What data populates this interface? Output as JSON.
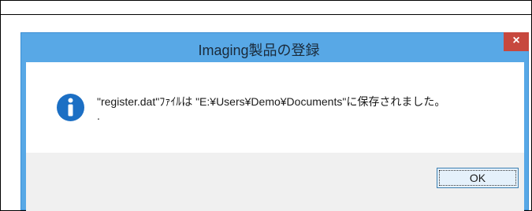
{
  "dialog": {
    "title": "Imaging製品の登録",
    "close_glyph": "×",
    "message": "\"register.dat\"ﾌｧｲﾙは \"E:¥Users¥Demo¥Documents\"に保存されました。",
    "message_dot": ".",
    "ok_label": "OK",
    "icon": "info-icon",
    "accent_color": "#58a8e6",
    "close_color": "#c7483e",
    "icon_color": "#1c6fc4"
  }
}
